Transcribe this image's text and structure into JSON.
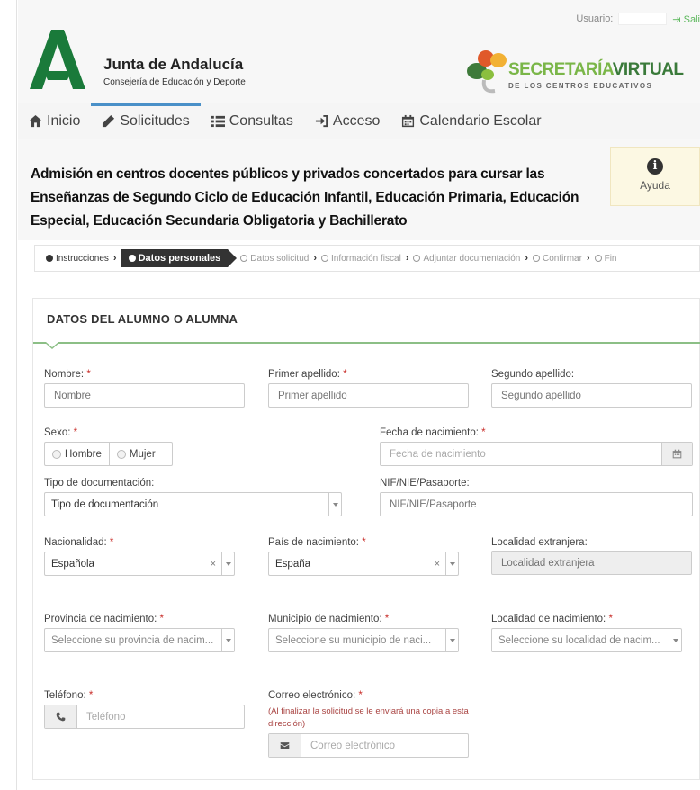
{
  "header": {
    "user_label": "Usuario:",
    "exit_label": "Sali",
    "org_title": "Junta de Andalucía",
    "org_subtitle": "Consejería de Educación y Deporte",
    "sv_title_a": "SECRETARÍA",
    "sv_title_b": "VIRTUAL",
    "sv_subtitle": "DE LOS CENTROS EDUCATIVOS"
  },
  "nav": [
    {
      "label": "Inicio",
      "icon": "home-icon"
    },
    {
      "label": "Solicitudes",
      "icon": "pencil-icon",
      "active": true
    },
    {
      "label": "Consultas",
      "icon": "list-icon"
    },
    {
      "label": "Acceso",
      "icon": "sign-in-icon"
    },
    {
      "label": "Calendario Escolar",
      "icon": "calendar-icon"
    }
  ],
  "page": {
    "title": "Admisión en centros docentes públicos y privados concertados para cursar las Enseñanzas de Segundo Ciclo de Educación Infantil, Educación Primaria, Educación Especial, Educación Secundaria Obligatoria y Bachillerato",
    "help_label": "Ayuda"
  },
  "steps": [
    {
      "label": "Instrucciones",
      "state": "done"
    },
    {
      "label": "Datos personales",
      "state": "current"
    },
    {
      "label": "Datos solicitud",
      "state": "pending"
    },
    {
      "label": "Información fiscal",
      "state": "pending"
    },
    {
      "label": "Adjuntar documentación",
      "state": "pending"
    },
    {
      "label": "Confirmar",
      "state": "pending"
    },
    {
      "label": "Fin",
      "state": "pending"
    }
  ],
  "form": {
    "section_title": "DATOS DEL ALUMNO O ALUMNA",
    "required_mark": "*",
    "nombre": {
      "label": "Nombre:",
      "placeholder": "Nombre"
    },
    "apellido1": {
      "label": "Primer apellido:",
      "placeholder": "Primer apellido"
    },
    "apellido2": {
      "label": "Segundo apellido:",
      "placeholder": "Segundo apellido"
    },
    "sexo": {
      "label": "Sexo:",
      "options": [
        "Hombre",
        "Mujer"
      ]
    },
    "fecha": {
      "label": "Fecha de nacimiento:",
      "placeholder": "Fecha de nacimiento"
    },
    "tipo_doc": {
      "label": "Tipo de documentación:",
      "value": "Tipo de documentación"
    },
    "nif": {
      "label": "NIF/NIE/Pasaporte:",
      "placeholder": "NIF/NIE/Pasaporte"
    },
    "nacionalidad": {
      "label": "Nacionalidad:",
      "value": "Española"
    },
    "pais": {
      "label": "País de nacimiento:",
      "value": "España"
    },
    "localidad_ext": {
      "label": "Localidad extranjera:",
      "placeholder": "Localidad extranjera"
    },
    "provincia": {
      "label": "Provincia de nacimiento:",
      "value": "Seleccione su provincia de nacim..."
    },
    "municipio": {
      "label": "Municipio de nacimiento:",
      "value": "Seleccione su municipio de naci..."
    },
    "localidad": {
      "label": "Localidad de nacimiento:",
      "value": "Seleccione su localidad de nacim..."
    },
    "telefono": {
      "label": "Teléfono:",
      "placeholder": "Teléfono"
    },
    "correo": {
      "label": "Correo electrónico:",
      "note": "(Al finalizar la solicitud se le enviará una copia a esta dirección)",
      "placeholder": "Correo electrónico"
    }
  },
  "colors": {
    "accent_green": "#7ab648",
    "required_red": "#c9302c",
    "active_tab": "#4a90c8"
  }
}
